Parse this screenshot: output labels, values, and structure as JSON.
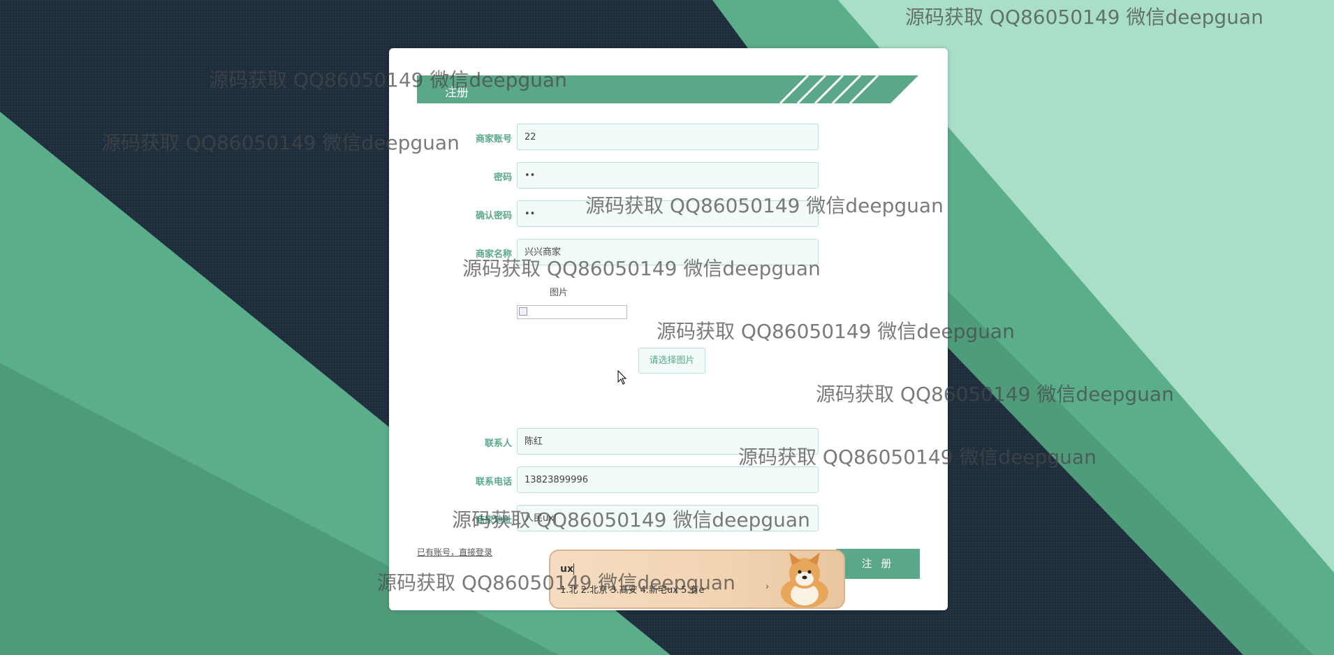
{
  "form": {
    "title": "注册",
    "fields": [
      {
        "label": "商家账号",
        "value": "22"
      },
      {
        "label": "密码",
        "value": "••"
      },
      {
        "label": "确认密码",
        "value": "••"
      },
      {
        "label": "商家名称",
        "value": "兴兴商家"
      },
      {
        "label": "联系人",
        "value": "陈红"
      },
      {
        "label": "联系电话",
        "value": "13823899996"
      },
      {
        "label": "商家地址",
        "value": "人民ux|"
      }
    ],
    "image_label": "图片",
    "choose_image_button": "请选择图片",
    "login_link": "已有账号，直接登录",
    "register_button": "注 册"
  },
  "ime": {
    "composition": "ux",
    "candidates": "1.北 2.北京 3.高安 4.新宅ux 5.有e"
  },
  "watermark": "源码获取 QQ86050149 微信deepguan",
  "colors": {
    "accent": "#5aa888",
    "dark_bg": "#1d2b39",
    "light_green": "#a8dfc6"
  }
}
